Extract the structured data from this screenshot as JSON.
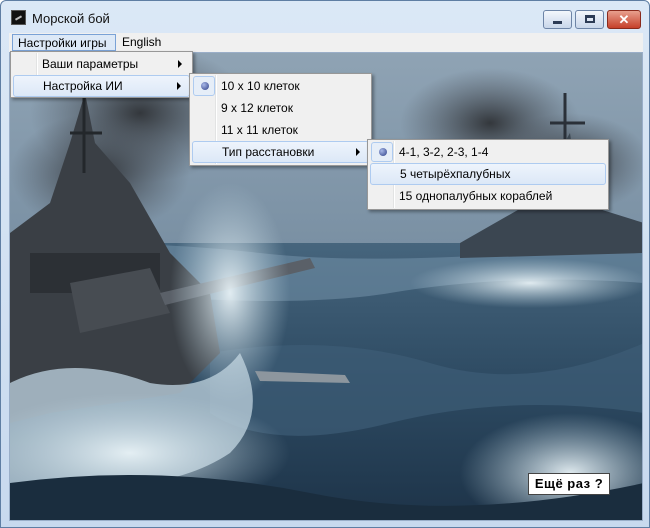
{
  "window": {
    "title": "Морской бой",
    "controls": {
      "minimize": "▁",
      "maximize": "□",
      "close": "✕"
    }
  },
  "menubar": {
    "items": [
      {
        "label": "Настройки игры",
        "open": true
      },
      {
        "label": "English"
      }
    ]
  },
  "settings_menu": {
    "items": [
      {
        "label": "Ваши параметры",
        "has_submenu": true
      },
      {
        "label": "Настройка ИИ",
        "has_submenu": true,
        "highlighted": true
      }
    ]
  },
  "ai_menu": {
    "items": [
      {
        "label": "10 x 10 клеток",
        "checked": true
      },
      {
        "label": "9 x 12 клеток"
      },
      {
        "label": "11 x 11 клеток"
      },
      {
        "label": "Тип расстановки",
        "has_submenu": true,
        "highlighted": true
      }
    ]
  },
  "placement_menu": {
    "items": [
      {
        "label": "4-1, 3-2, 2-3, 1-4",
        "checked": true
      },
      {
        "label": "5 четырёхпалубных",
        "highlighted": true
      },
      {
        "label": "15 однопалубных кораблей"
      }
    ]
  },
  "restart_button": {
    "label": "Ещё раз ?"
  },
  "colors": {
    "menu_highlight_border": "#aecbf0",
    "radio_dot": "#2e3f86",
    "close_button": "#c6402a"
  }
}
